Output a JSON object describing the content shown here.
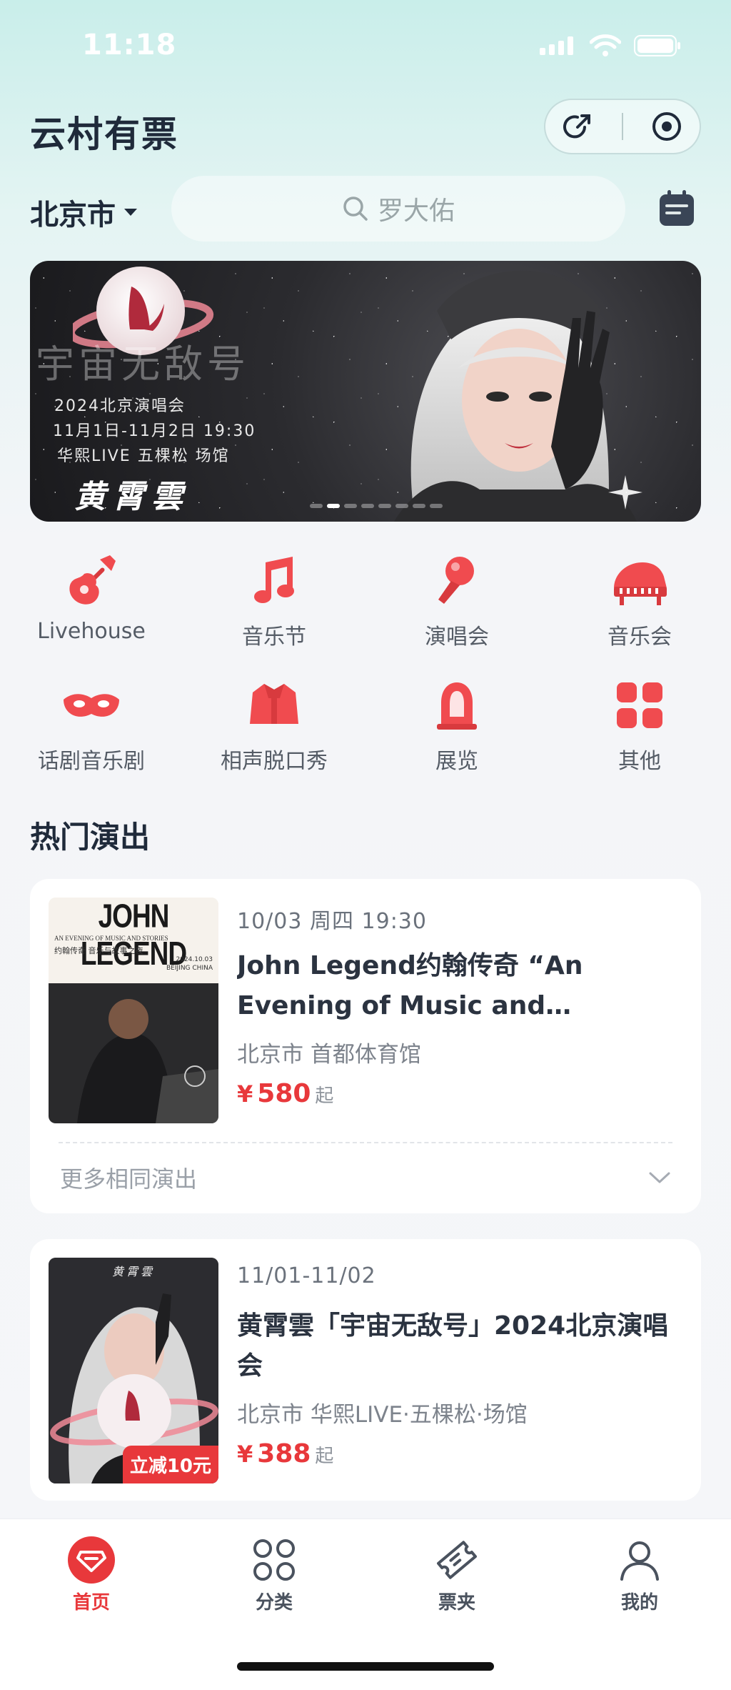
{
  "status_bar": {
    "time": "11:18"
  },
  "header": {
    "title": "云村有票"
  },
  "location": {
    "city": "北京市"
  },
  "search": {
    "placeholder": "罗大佑"
  },
  "banner": {
    "headline": "宇宙无敌号",
    "line1": "2024北京演唱会",
    "line2": "11月1日-11月2日 19:30",
    "line3": "华熙LIVE 五棵松 场馆",
    "artist": "黄霄雲",
    "dot_count": 8,
    "active_dot": 1
  },
  "categories": [
    {
      "label": "Livehouse",
      "icon": "guitar-icon"
    },
    {
      "label": "音乐节",
      "icon": "music-note-icon"
    },
    {
      "label": "演唱会",
      "icon": "microphone-icon"
    },
    {
      "label": "音乐会",
      "icon": "piano-icon"
    },
    {
      "label": "话剧音乐剧",
      "icon": "mask-icon"
    },
    {
      "label": "相声脱口秀",
      "icon": "gown-icon"
    },
    {
      "label": "展览",
      "icon": "frame-icon"
    },
    {
      "label": "其他",
      "icon": "grid-icon"
    }
  ],
  "section": {
    "title": "热门演出"
  },
  "shows": [
    {
      "date": "10/03  周四  19:30",
      "title": "John Legend约翰传奇 “An Evening of Music and Stories-...",
      "venue": "北京市 首都体育馆",
      "price_symbol": "¥",
      "price": "580",
      "price_suffix": "起",
      "more_label": "更多相同演出",
      "poster": {
        "heading": "JOHN LEGEND",
        "sub1": "AN EVENING OF MUSIC AND STORIES",
        "sub2": "约翰传奇  音乐与故事之夜",
        "sub3": "2024.10.03",
        "sub4": "BEIJING CHINA"
      }
    },
    {
      "date": "11/01-11/02",
      "title": "黄霄雲「宇宙无敌号」2024北京演唱会",
      "venue": "北京市 华熙LIVE·五棵松·场馆",
      "price_symbol": "¥",
      "price": "388",
      "price_suffix": "起",
      "promo": "立减10元",
      "poster": {
        "heading": "黄霄雲"
      }
    }
  ],
  "tabbar": [
    {
      "label": "首页",
      "icon": "home-ticket-icon",
      "active": true
    },
    {
      "label": "分类",
      "icon": "categories-icon",
      "active": false
    },
    {
      "label": "票夹",
      "icon": "ticket-icon",
      "active": false
    },
    {
      "label": "我的",
      "icon": "profile-icon",
      "active": false
    }
  ],
  "colors": {
    "accent": "#e8383b",
    "title": "#1f2a3a",
    "background_top": "#c9eeea"
  }
}
